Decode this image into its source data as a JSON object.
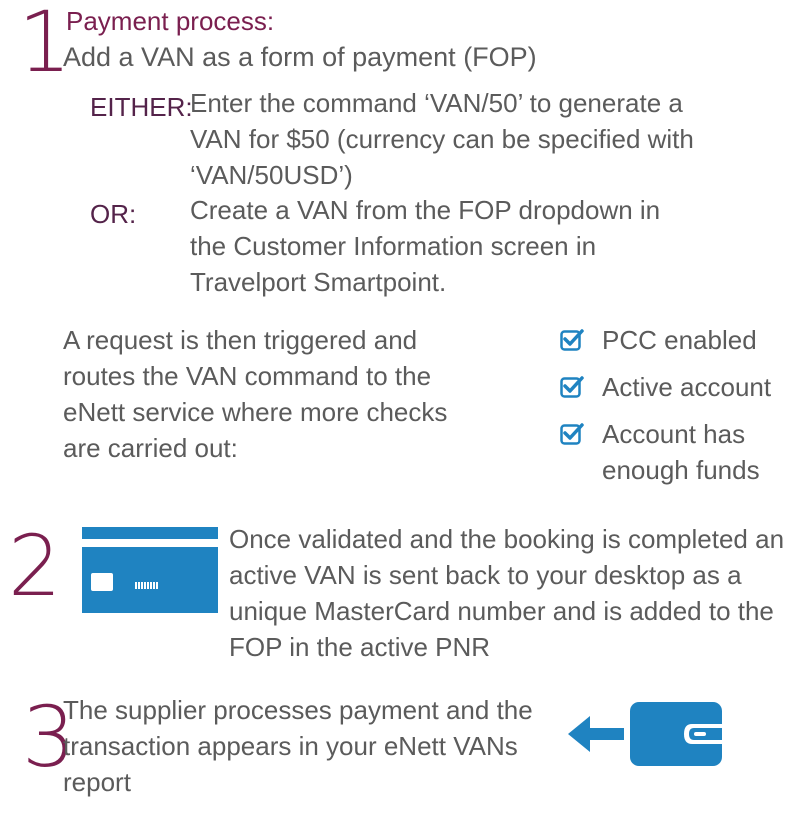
{
  "step1": {
    "number": "1",
    "title": "Payment process:",
    "subtitle": "Add a VAN as a form of payment (FOP)",
    "either_label": "EITHER:",
    "either_text": "Enter the command ‘VAN/50’ to generate a VAN for $50 (currency can be specified with ‘VAN/50USD’)",
    "or_label": "OR:",
    "or_text": "Create a VAN from the FOP dropdown in the Customer Information screen in Travelport Smartpoint.",
    "request_text": "A request is then triggered and routes the VAN command to the eNett service where more checks are carried out:",
    "checks": [
      {
        "line1": "PCC enabled",
        "line2": ""
      },
      {
        "line1": "Active account",
        "line2": ""
      },
      {
        "line1": "Account has",
        "line2": "enough funds"
      }
    ]
  },
  "step2": {
    "number": "2",
    "text": "Once validated and the booking is completed an active VAN is sent back to your desktop as a unique MasterCard number and is added to the FOP in the active PNR",
    "icon": "credit-card-icon"
  },
  "step3": {
    "number": "3",
    "text": "The supplier processes payment and the transaction appears in your eNett VANs report",
    "icons": [
      "arrow-left-icon",
      "wallet-icon"
    ]
  },
  "colors": {
    "accent": "#7a1f4f",
    "label": "#54234a",
    "text": "#5b5b5b",
    "icon_blue": "#1f83c1"
  }
}
